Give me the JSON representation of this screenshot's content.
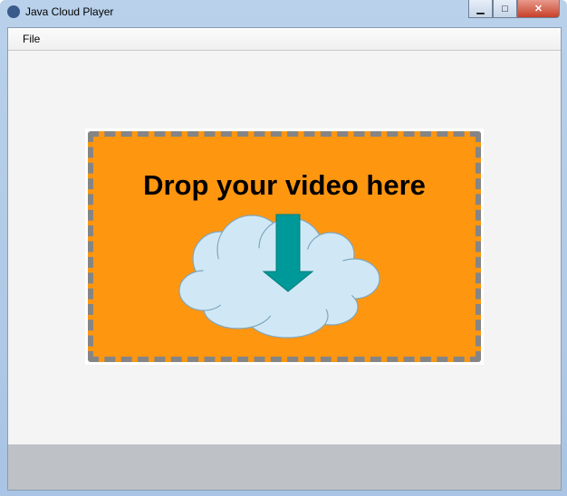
{
  "window": {
    "title": "Java Cloud Player",
    "minimize_icon": "minimize-icon",
    "maximize_icon": "maximize-icon",
    "close_icon": "close-icon"
  },
  "menubar": {
    "items": [
      {
        "label": "File"
      }
    ]
  },
  "dropzone": {
    "title": "Drop your video here",
    "icon": "cloud-upload-icon",
    "colors": {
      "fill": "#ff9610",
      "border": "#858585",
      "arrow": "#009999",
      "cloud": "#d0e8f5"
    }
  }
}
